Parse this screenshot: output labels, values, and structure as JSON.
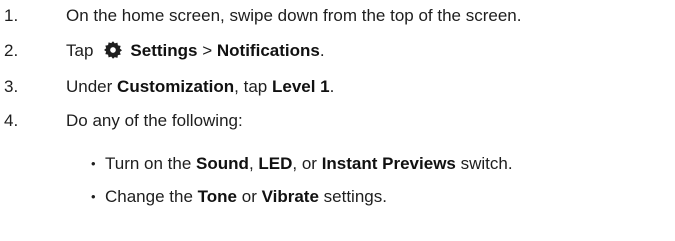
{
  "steps": [
    {
      "number": "1.",
      "text": "On the home screen, swipe down from the top of the screen."
    },
    {
      "number": "2.",
      "prefix": "Tap",
      "icon": "gear-icon",
      "settings": "Settings",
      "separator": ">",
      "notifications": "Notifications",
      "end": "."
    },
    {
      "number": "3.",
      "prefix": "Under",
      "customization": "Customization",
      "comma_tap": ", tap",
      "level": "Level 1",
      "end": "."
    },
    {
      "number": "4.",
      "text": "Do any of the following:"
    }
  ],
  "bullets": [
    {
      "symbol": "•",
      "prefix": "Turn on the",
      "sound": "Sound",
      "comma1": ",",
      "led": "LED",
      "comma_or": ", or",
      "previews": "Instant Previews",
      "suffix": "switch."
    },
    {
      "symbol": "•",
      "prefix": "Change the",
      "tone": "Tone",
      "or": "or",
      "vibrate": "Vibrate",
      "suffix": "settings."
    }
  ]
}
